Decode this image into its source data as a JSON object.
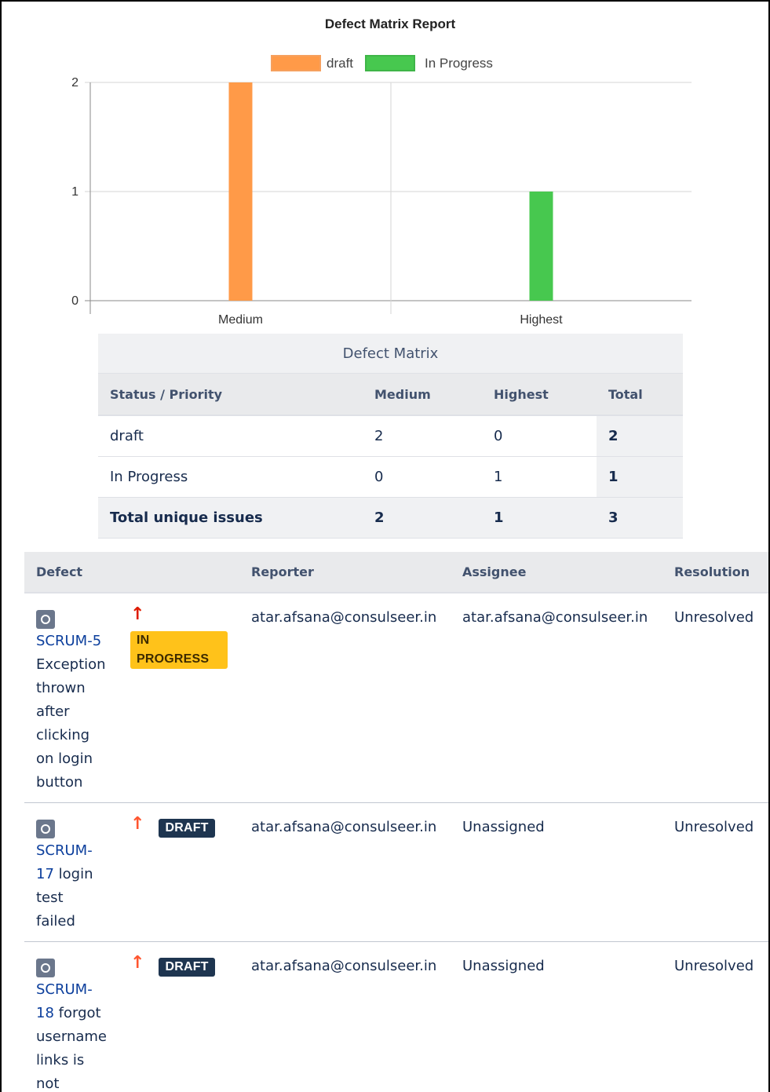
{
  "chart_data": {
    "type": "bar",
    "title": "Defect Matrix Report",
    "categories": [
      "Medium",
      "Highest"
    ],
    "series": [
      {
        "name": "draft",
        "values": [
          2,
          0
        ],
        "color": "#ff9a48"
      },
      {
        "name": "In Progress",
        "values": [
          0,
          1
        ],
        "color": "#47c84f"
      }
    ],
    "yticks": [
      "0",
      "1",
      "2"
    ],
    "ylim": [
      0,
      2
    ],
    "grid": true,
    "legend": "top-center"
  },
  "matrix": {
    "caption": "Defect Matrix",
    "headers": [
      "Status / Priority",
      "Medium",
      "Highest",
      "Total"
    ],
    "rows": [
      {
        "label": "draft",
        "medium": "2",
        "highest": "0",
        "total": "2"
      },
      {
        "label": "In Progress",
        "medium": "0",
        "highest": "1",
        "total": "1"
      }
    ],
    "total_row": {
      "label": "Total unique issues",
      "medium": "2",
      "highest": "1",
      "total": "3"
    }
  },
  "issues": {
    "headers": [
      "Defect",
      "",
      "Reporter",
      "Assignee",
      "Resolution"
    ],
    "rows": [
      {
        "key": "SCRUM-5",
        "summary": "Exception thrown after clicking on login button",
        "priority_icon": "priority-highest-icon",
        "status": "IN PROGRESS",
        "reporter": "atar.afsana@consulseer.in",
        "assignee": "atar.afsana@consulseer.in",
        "resolution": "Unresolved"
      },
      {
        "key": "SCRUM-17",
        "summary": "login test failed",
        "priority_icon": "priority-medium-icon",
        "status": "DRAFT",
        "reporter": "atar.afsana@consulseer.in",
        "assignee": "Unassigned",
        "resolution": "Unresolved"
      },
      {
        "key": "SCRUM-18",
        "summary": "forgot username links is not visible",
        "priority_icon": "priority-medium-icon",
        "status": "DRAFT",
        "reporter": "atar.afsana@consulseer.in",
        "assignee": "Unassigned",
        "resolution": "Unresolved"
      }
    ]
  },
  "colors": {
    "link": "#0b3e9c",
    "in_progress_lozenge": "#ffc21a",
    "draft_lozenge": "#1e3550",
    "priority_arrow": "#ff5630"
  }
}
